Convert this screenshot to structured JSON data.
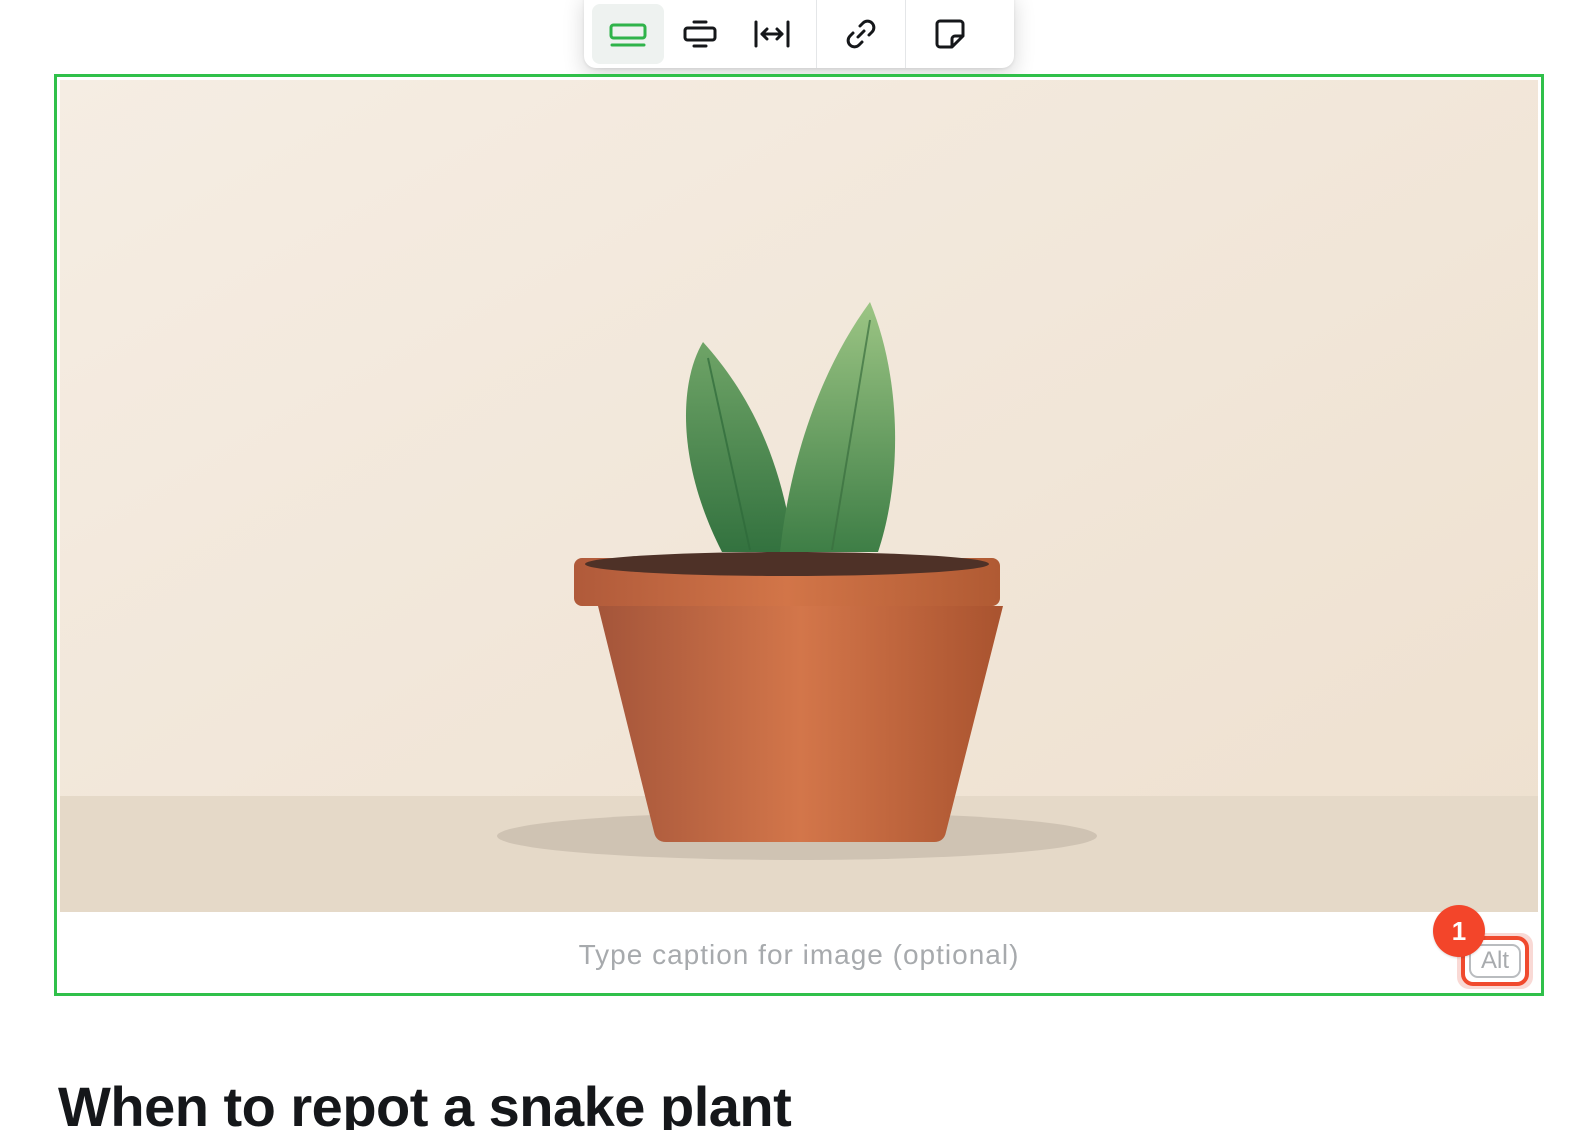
{
  "toolbar": {
    "buttons": [
      {
        "icon": "image-wide-icon",
        "active": true
      },
      {
        "icon": "image-regular-icon",
        "active": false
      },
      {
        "icon": "image-full-width-icon",
        "active": false
      },
      {
        "icon": "link-icon",
        "active": false
      },
      {
        "icon": "snippet-icon",
        "active": false
      }
    ]
  },
  "image": {
    "subject": "potted-plant-illustration"
  },
  "caption": {
    "placeholder": "Type caption for image (optional)"
  },
  "alt_button": {
    "label": "Alt"
  },
  "annotation": {
    "badge_number": "1"
  },
  "content": {
    "heading": "When to repot a snake plant"
  },
  "colors": {
    "selection_border": "#30c04a",
    "badge": "#f3452a",
    "alt_highlight": "#f04a2e",
    "active_icon": "#2fb34a"
  }
}
